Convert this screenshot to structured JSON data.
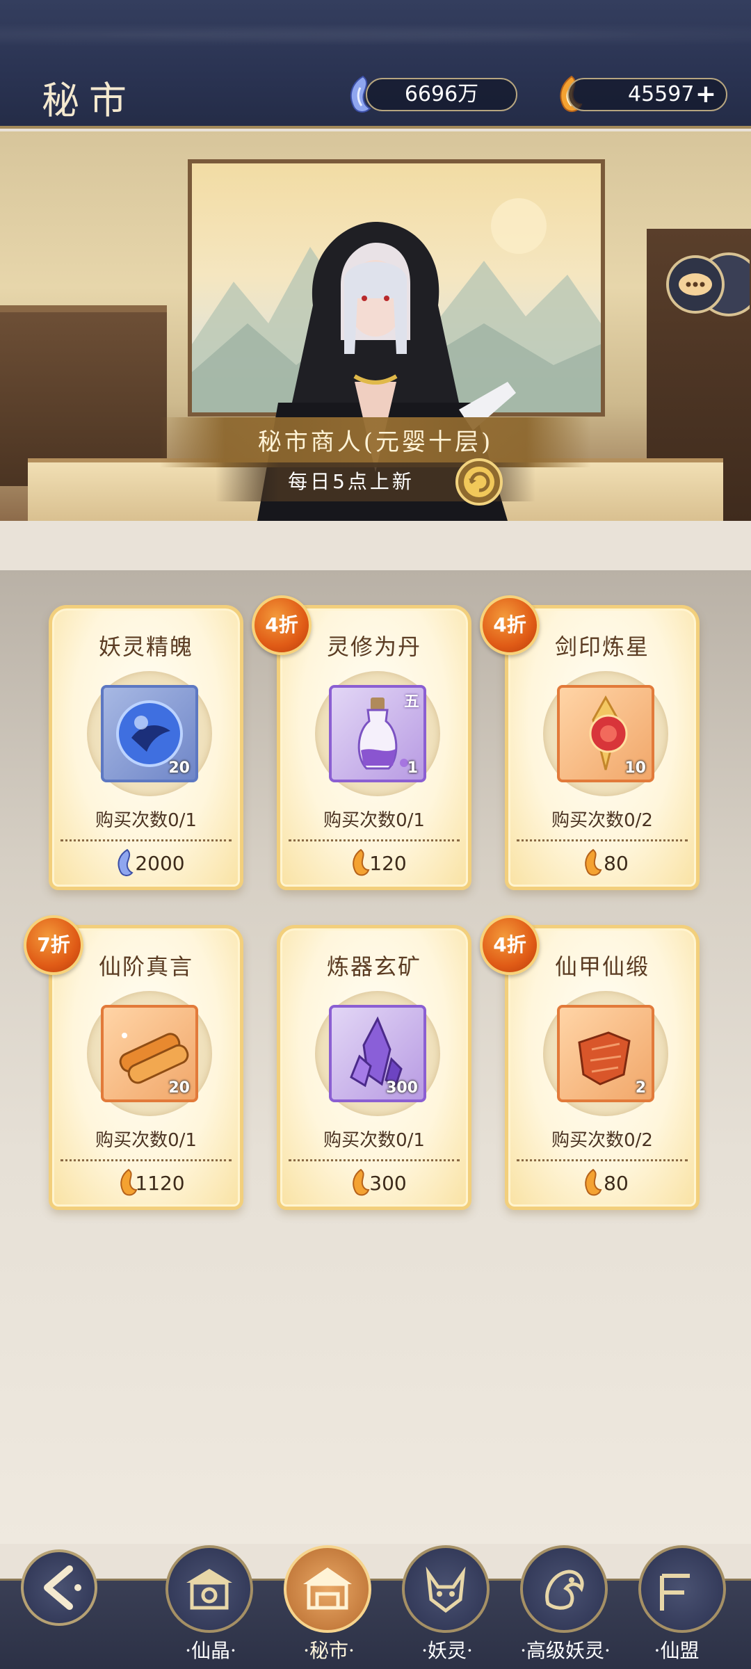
{
  "header": {
    "title": "秘市",
    "spirit_stones": "6696万",
    "gold": "45597",
    "plus_label": "+"
  },
  "scene": {
    "merchant_title": "秘市商人(元婴十层)",
    "refresh_note": "每日5点上新"
  },
  "items": [
    {
      "name": "妖灵精魄",
      "quantity": "20",
      "limit": "购买次数0/1",
      "price": "2000",
      "currency": "spirit-stone",
      "discount": "",
      "grade": ""
    },
    {
      "name": "灵修为丹",
      "quantity": "1",
      "limit": "购买次数0/1",
      "price": "120",
      "currency": "gold",
      "discount": "4折",
      "grade": "五"
    },
    {
      "name": "剑印炼星",
      "quantity": "10",
      "limit": "购买次数0/2",
      "price": "80",
      "currency": "gold",
      "discount": "4折",
      "grade": ""
    },
    {
      "name": "仙阶真言",
      "quantity": "20",
      "limit": "购买次数0/1",
      "price": "1120",
      "currency": "gold",
      "discount": "7折",
      "grade": ""
    },
    {
      "name": "炼器玄矿",
      "quantity": "300",
      "limit": "购买次数0/1",
      "price": "300",
      "currency": "gold",
      "discount": "",
      "grade": ""
    },
    {
      "name": "仙甲仙缎",
      "quantity": "2",
      "limit": "购买次数0/2",
      "price": "80",
      "currency": "gold",
      "discount": "4折",
      "grade": ""
    }
  ],
  "nav": [
    {
      "label": "·仙晶·",
      "active": false
    },
    {
      "label": "·秘市·",
      "active": true
    },
    {
      "label": "·妖灵·",
      "active": false
    },
    {
      "label": "·高级妖灵·",
      "active": false
    },
    {
      "label": "·仙盟",
      "active": false
    }
  ],
  "colors": {
    "header_bg": "#2a3352",
    "card_border": "#f2cf7c",
    "discount_badge": "#e05b16",
    "nav_bg": "#2c3146",
    "active_nav": "#e9a866"
  }
}
